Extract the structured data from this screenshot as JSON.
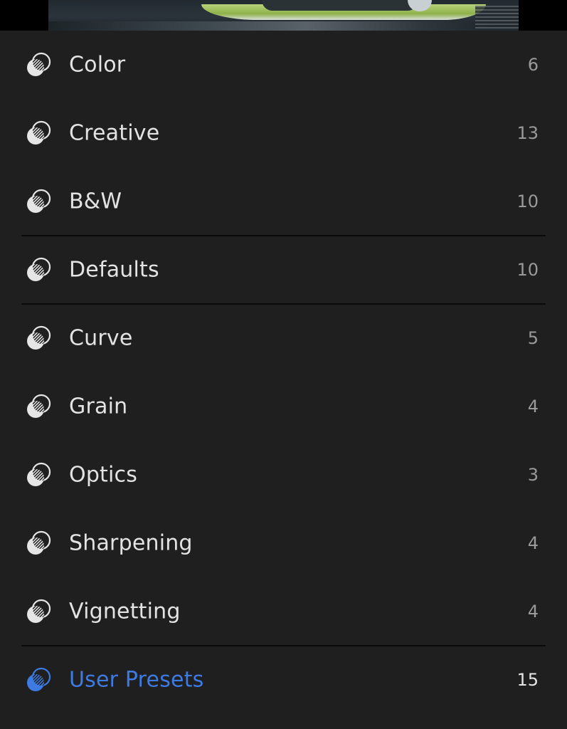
{
  "photo": {
    "description_icon": "photo-preview"
  },
  "preset_groups": [
    {
      "label": "Color",
      "count": "6",
      "active": false,
      "icon": "preset-group-icon"
    },
    {
      "label": "Creative",
      "count": "13",
      "active": false,
      "icon": "preset-group-icon"
    },
    {
      "label": "B&W",
      "count": "10",
      "active": false,
      "icon": "preset-group-icon"
    },
    {
      "label": "Defaults",
      "count": "10",
      "active": false,
      "icon": "preset-group-icon"
    },
    {
      "label": "Curve",
      "count": "5",
      "active": false,
      "icon": "preset-group-icon"
    },
    {
      "label": "Grain",
      "count": "4",
      "active": false,
      "icon": "preset-group-icon"
    },
    {
      "label": "Optics",
      "count": "3",
      "active": false,
      "icon": "preset-group-icon"
    },
    {
      "label": "Sharpening",
      "count": "4",
      "active": false,
      "icon": "preset-group-icon"
    },
    {
      "label": "Vignetting",
      "count": "4",
      "active": false,
      "icon": "preset-group-icon"
    },
    {
      "label": "User Presets",
      "count": "15",
      "active": true,
      "icon": "preset-group-icon"
    }
  ],
  "colors": {
    "panel_background": "#1f1f1f",
    "label_text": "#e3e3e3",
    "count_text": "#9a9a9a",
    "active_accent": "#3d7be3",
    "icon_default": "#e6e6e6"
  }
}
